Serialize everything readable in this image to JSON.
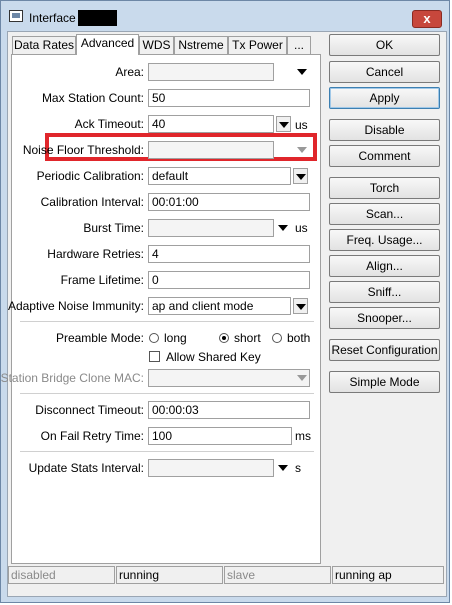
{
  "window": {
    "title": "Interface",
    "close_symbol": "x"
  },
  "tabs": [
    "Data Rates",
    "Advanced",
    "WDS",
    "Nstreme",
    "Tx Power",
    "..."
  ],
  "fields": {
    "area": {
      "label": "Area:",
      "value": ""
    },
    "max_station_count": {
      "label": "Max Station Count:",
      "value": "50"
    },
    "ack_timeout": {
      "label": "Ack Timeout:",
      "value": "40",
      "unit": "us"
    },
    "noise_floor_threshold": {
      "label": "Noise Floor Threshold:",
      "value": ""
    },
    "periodic_calibration": {
      "label": "Periodic Calibration:",
      "value": "default"
    },
    "calibration_interval": {
      "label": "Calibration Interval:",
      "value": "00:01:00"
    },
    "burst_time": {
      "label": "Burst Time:",
      "value": "",
      "unit": "us"
    },
    "hardware_retries": {
      "label": "Hardware Retries:",
      "value": "4"
    },
    "frame_lifetime": {
      "label": "Frame Lifetime:",
      "value": "0"
    },
    "adaptive_noise_immunity": {
      "label": "Adaptive Noise Immunity:",
      "value": "ap and client mode"
    },
    "preamble_mode": {
      "label": "Preamble Mode:",
      "options": [
        "long",
        "short",
        "both"
      ],
      "selected": "short"
    },
    "allow_shared_key": {
      "label": "Allow Shared Key",
      "checked": false
    },
    "station_bridge_clone_mac": {
      "label": "Station Bridge Clone MAC:",
      "value": ""
    },
    "disconnect_timeout": {
      "label": "Disconnect Timeout:",
      "value": "00:00:03"
    },
    "on_fail_retry_time": {
      "label": "On Fail Retry Time:",
      "value": "100",
      "unit": "ms"
    },
    "update_stats_interval": {
      "label": "Update Stats Interval:",
      "value": "",
      "unit": "s"
    }
  },
  "buttons": {
    "ok": "OK",
    "cancel": "Cancel",
    "apply": "Apply",
    "disable": "Disable",
    "comment": "Comment",
    "torch": "Torch",
    "scan": "Scan...",
    "freq_usage": "Freq. Usage...",
    "align": "Align...",
    "sniff": "Sniff...",
    "snooper": "Snooper...",
    "reset_configuration": "Reset Configuration",
    "simple_mode": "Simple Mode"
  },
  "status": [
    "disabled",
    "running",
    "slave",
    "running ap"
  ],
  "colors": {
    "highlight": "#e0262b",
    "title_bar": "#c9daec",
    "close_button": "#c7473c"
  }
}
